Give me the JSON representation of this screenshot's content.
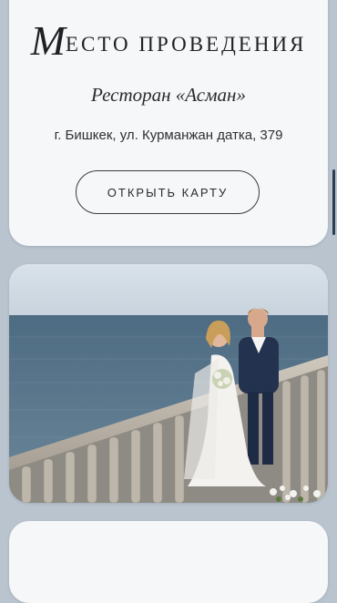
{
  "venue": {
    "title_first": "М",
    "title_rest": "есто проведения",
    "name": "Ресторан «Асман»",
    "address": "г. Бишкек, ул. Курманжан датка, 379",
    "map_button": "Открыть карту"
  },
  "photo": {
    "description_icon": "wedding-couple-photo"
  },
  "colors": {
    "page_bg": "#b9c4cf",
    "card_bg": "#f6f7f9",
    "text": "#1f2024"
  }
}
